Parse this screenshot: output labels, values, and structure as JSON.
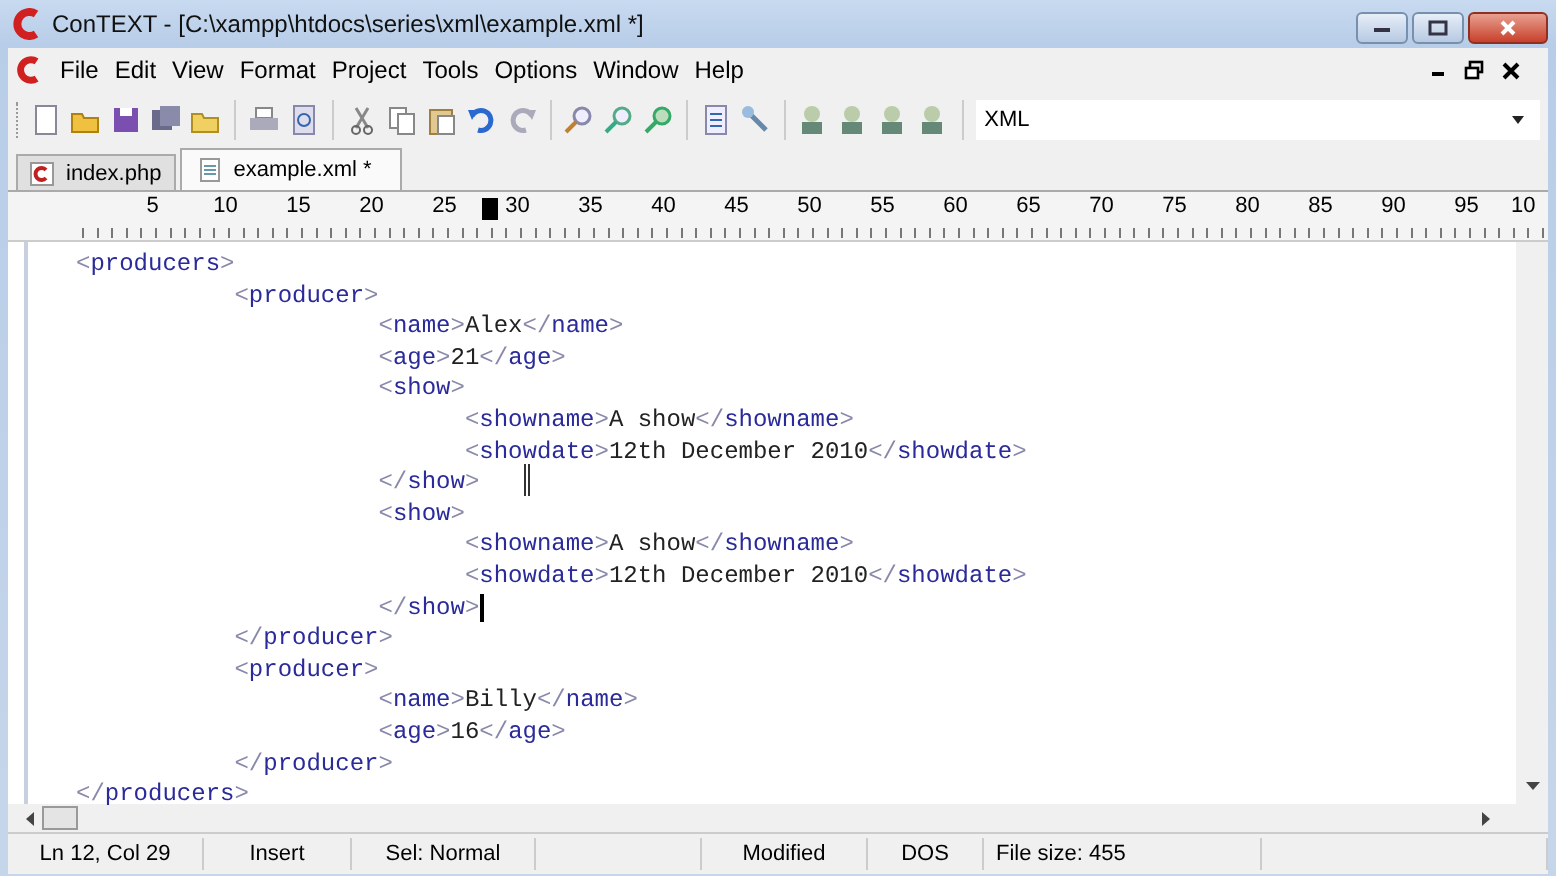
{
  "window": {
    "title": "ConTEXT - [C:\\xampp\\htdocs\\series\\xml\\example.xml *]"
  },
  "menu": [
    "File",
    "Edit",
    "View",
    "Format",
    "Project",
    "Tools",
    "Options",
    "Window",
    "Help"
  ],
  "toolbar": {
    "highlighter": "XML"
  },
  "tabs": [
    {
      "label": "index.php",
      "selected": false
    },
    {
      "label": "example.xml *",
      "selected": true
    }
  ],
  "ruler": [
    "5",
    "10",
    "15",
    "20",
    "25",
    "30",
    "35",
    "40",
    "45",
    "50",
    "55",
    "60",
    "65",
    "70",
    "75",
    "80",
    "85",
    "90",
    "95",
    "10"
  ],
  "editor": {
    "lines": [
      "<producers>",
      "           <producer>",
      "                     <name>Alex</name>",
      "                     <age>21</age>",
      "                     <show>",
      "                           <showname>A show</showname>",
      "                           <showdate>12th December 2010</showdate>",
      "                     </show>",
      "                     <show>",
      "                           <showname>A show</showname>",
      "                           <showdate>12th December 2010</showdate>",
      "                     </show>",
      "           </producer>",
      "           <producer>",
      "                     <name>Billy</name>",
      "                     <age>16</age>",
      "           </producer>",
      "</producers>"
    ]
  },
  "status_bar": [
    "Ln 12, Col 29",
    "Insert",
    "Sel: Normal",
    "Modified",
    "DOS",
    "File size: 455"
  ]
}
